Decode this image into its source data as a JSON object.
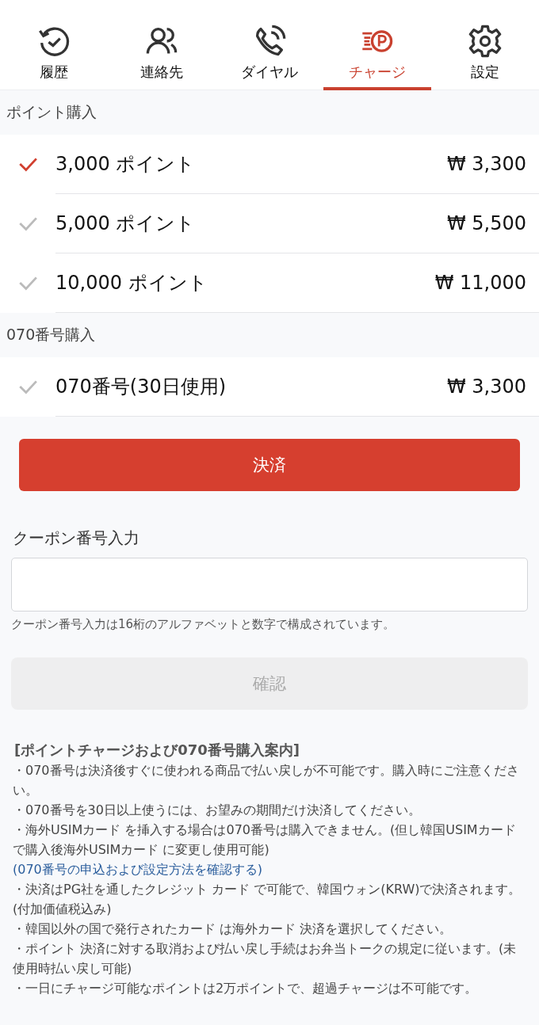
{
  "tabs": [
    {
      "label": "履歴",
      "selected": false
    },
    {
      "label": "連絡先",
      "selected": false
    },
    {
      "label": "ダイヤル",
      "selected": false
    },
    {
      "label": "チャージ",
      "selected": true
    },
    {
      "label": "設定",
      "selected": false
    }
  ],
  "sections": [
    {
      "title": "ポイント購入",
      "items": [
        {
          "name": "3,000 ポイント",
          "price": "₩ 3,300",
          "selected": true
        },
        {
          "name": "5,000 ポイント",
          "price": "₩ 5,500",
          "selected": false
        },
        {
          "name": "10,000 ポイント",
          "price": "₩ 11,000",
          "selected": false
        }
      ]
    },
    {
      "title": "070番号購入",
      "items": [
        {
          "name": "070番号(30日使用)",
          "price": "₩ 3,300",
          "selected": false
        }
      ]
    }
  ],
  "pay_button": {
    "label": "決済",
    "disabled": false
  },
  "coupon": {
    "label": "クーポン番号入力",
    "hint": "クーポン番号入力は16桁のアルファベットと数字で構成されています。"
  },
  "confirm_button": {
    "label": "確認",
    "disabled": true
  },
  "notice": {
    "title": "[ポイントチャージおよび070番号購入案内]",
    "lines": [
      {
        "kind": "text",
        "text": "・070番号は決済後すぐに使われる商品で払い戻しが不可能です。購入時にご注意ください。"
      },
      {
        "kind": "text",
        "text": "・070番号を30日以上使うには、お望みの期間だけ決済してください。"
      },
      {
        "kind": "text",
        "text": "・海外USIMカード を挿入する場合は070番号は購入できません。(但し韓国USIMカードで購入後海外USIMカード に変更し使用可能)"
      },
      {
        "kind": "link",
        "text": "(070番号の申込および設定方法を確認する)"
      },
      {
        "kind": "text",
        "text": "・決済はPG社を通したクレジット カード で可能で、韓国ウォン(KRW)で決済されます。(付加価値税込み)"
      },
      {
        "kind": "text",
        "text": "・韓国以外の国で発行されたカード は海外カード 決済を選択してください。"
      },
      {
        "kind": "text",
        "text": "・ポイント 決済に対する取消および払い戻し手続はお弁当トークの規定に従います。(未使用時払い戻し可能)"
      },
      {
        "kind": "text",
        "text": "・一日にチャージ可能なポイントは2万ポイントで、超過チャージは不可能です。"
      }
    ]
  }
}
